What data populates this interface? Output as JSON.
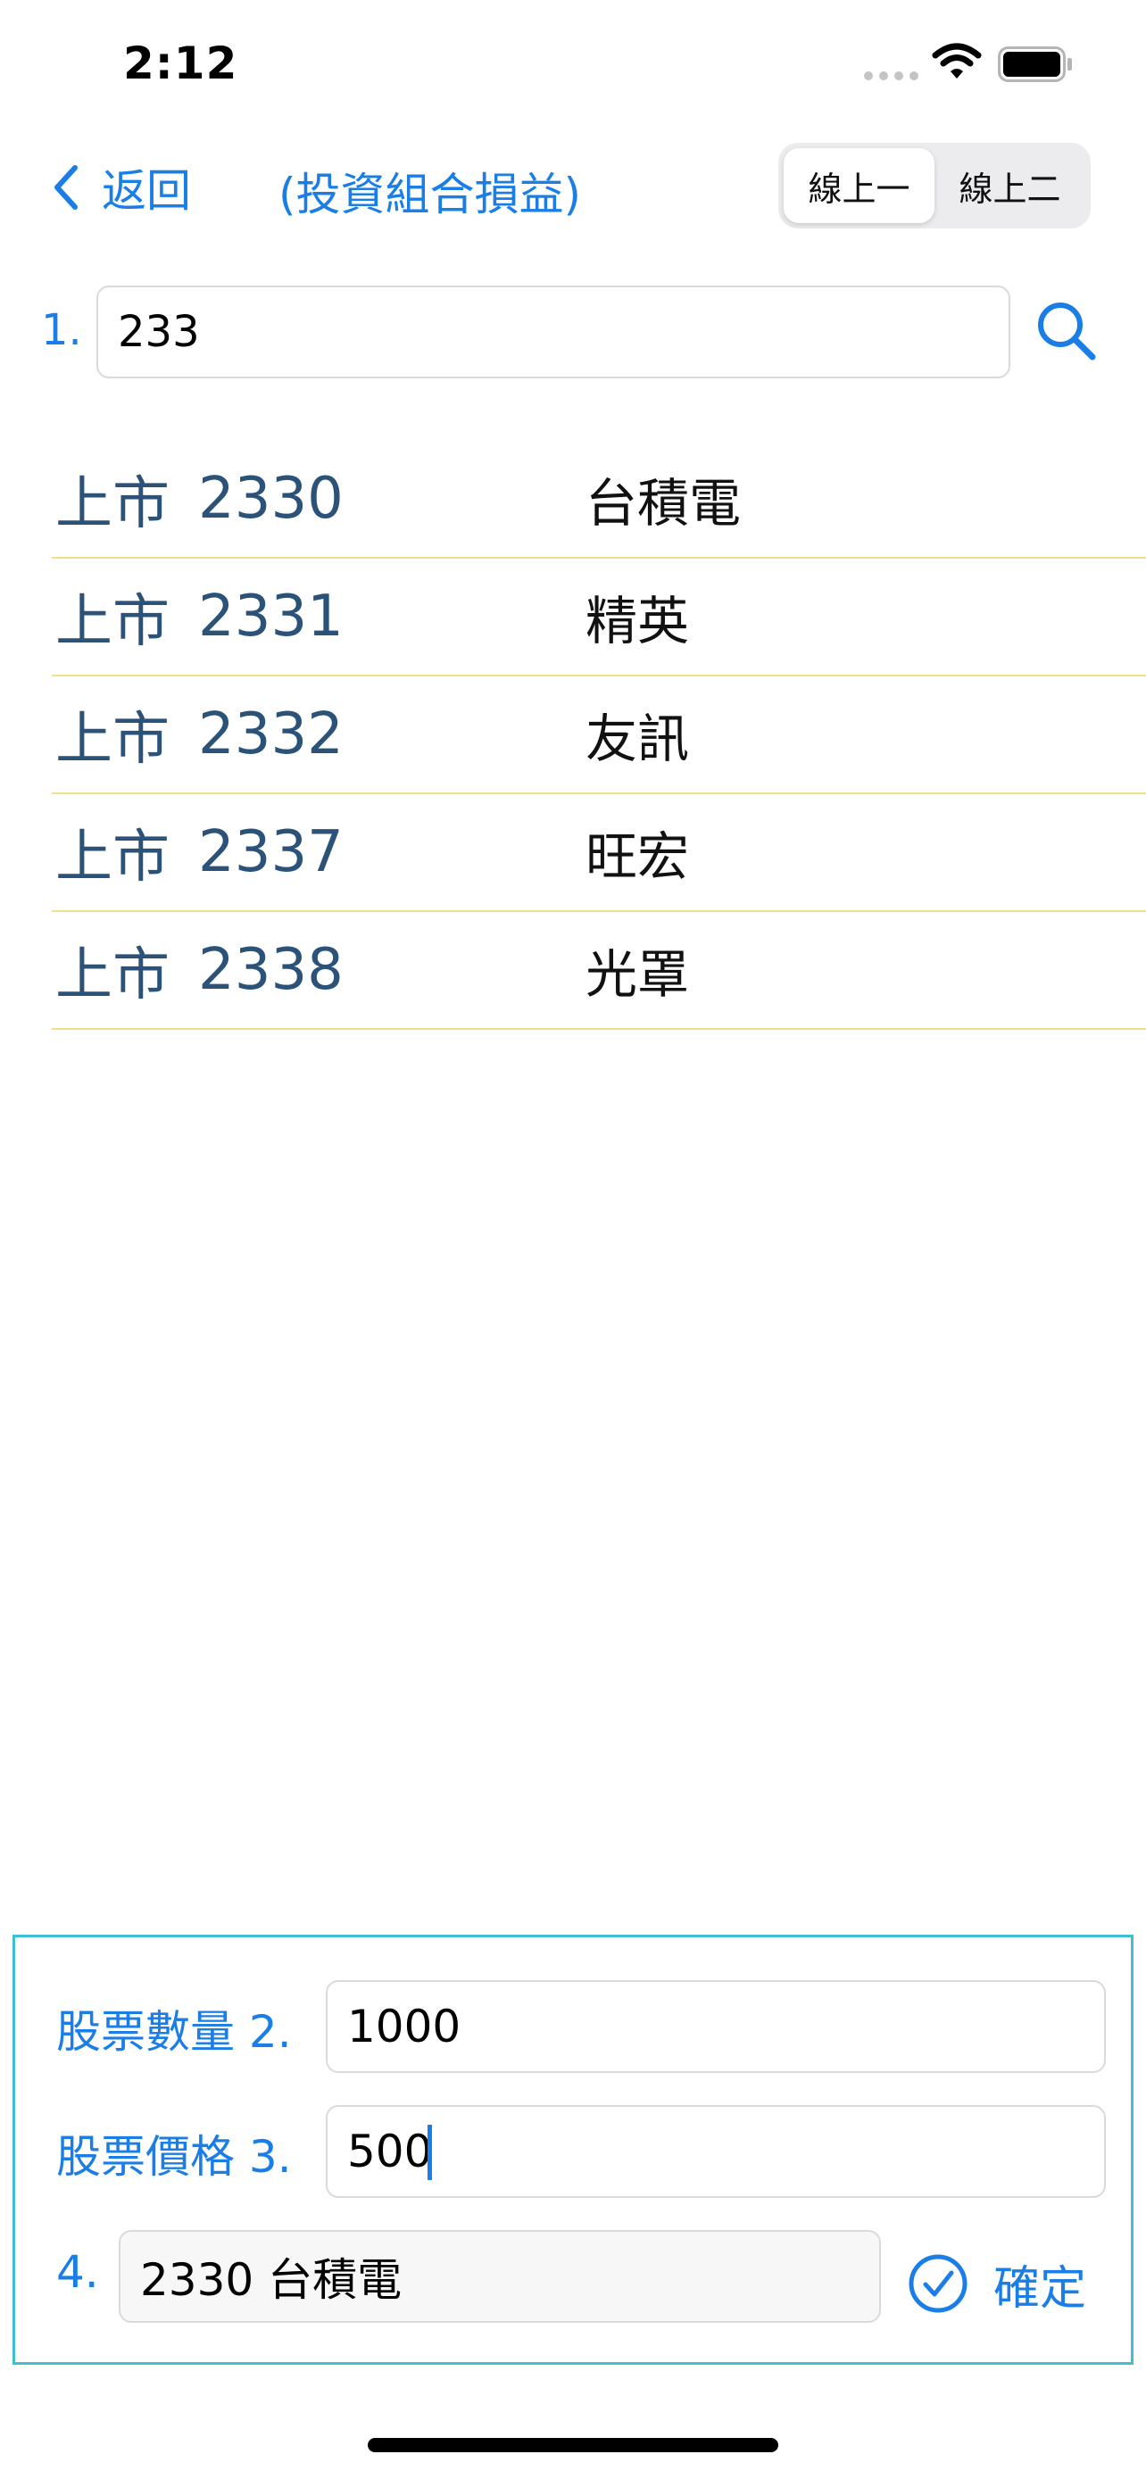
{
  "status_bar": {
    "time": "2:12"
  },
  "nav": {
    "back_label": "返回",
    "title": "(投資組合損益)",
    "segments": [
      "線上一",
      "線上二"
    ],
    "selected_segment": 0
  },
  "search": {
    "step": "1.",
    "value": "233"
  },
  "results": [
    {
      "market": "上市",
      "code": "2330",
      "name": "台積電"
    },
    {
      "market": "上市",
      "code": "2331",
      "name": "精英"
    },
    {
      "market": "上市",
      "code": "2332",
      "name": "友訊"
    },
    {
      "market": "上市",
      "code": "2337",
      "name": "旺宏"
    },
    {
      "market": "上市",
      "code": "2338",
      "name": "光罩"
    }
  ],
  "form": {
    "quantity_label": "股票數量 2.",
    "quantity_value": "1000",
    "price_label": "股票價格 3.",
    "price_value": "500",
    "selected_step": "4.",
    "selected_value": "2330 台積電",
    "confirm_label": "確定"
  },
  "colors": {
    "accent": "#1a7ee6",
    "row_text": "#2b5278",
    "row_divider": "#f0e08a",
    "panel_border": "#3fbfd3"
  }
}
